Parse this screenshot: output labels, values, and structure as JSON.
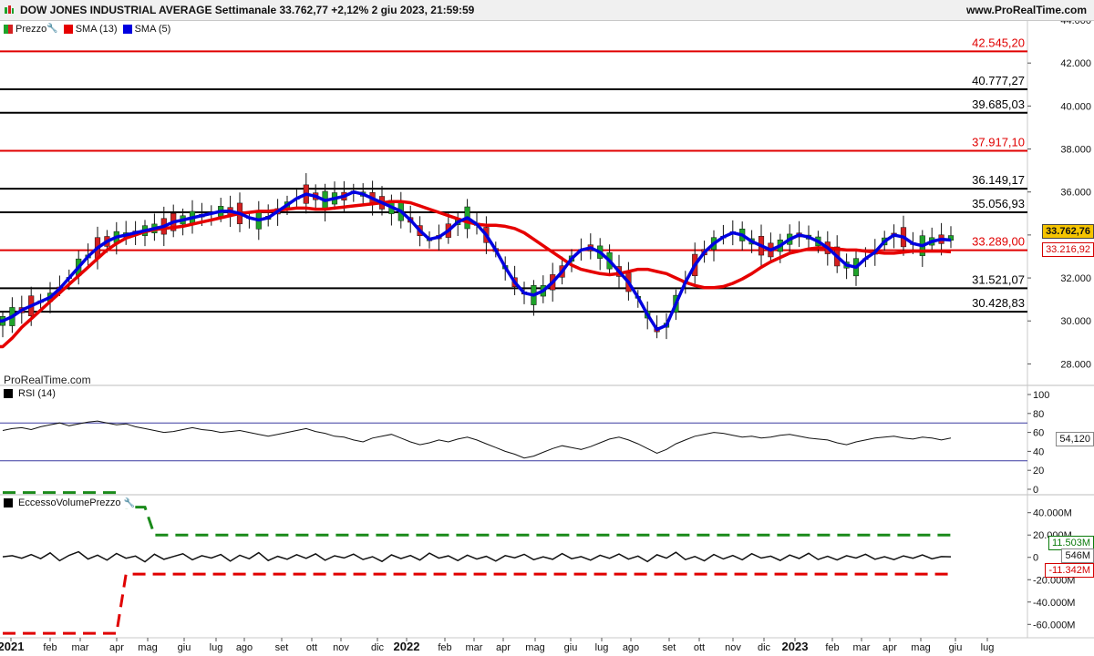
{
  "header": {
    "title": "DOW JONES INDUSTRIAL AVERAGE Settimanale 33.762,77 +2,12% 2 giu 2023, 21:59:59",
    "site": "www.ProRealTime.com"
  },
  "legend": {
    "price": "Prezzo",
    "sma13": "SMA (13)",
    "sma5": "SMA (5)"
  },
  "watermark": "ProRealTime.com",
  "rsi_label": "RSI (14)",
  "volume_label": "EccessoVolumePrezzo",
  "badges": {
    "close": "33.762,76",
    "sma13": "33.216,92",
    "rsi": "54,120",
    "vol_pos": "11.503M",
    "vol_value": "546M",
    "vol_neg": "-11.342M"
  },
  "colors": {
    "up": "#1fa32a",
    "down": "#d42020",
    "sma13": "#e60000",
    "sma5": "#0000e0",
    "level_red": "#e00000",
    "level_black": "#000000"
  },
  "chart_data": [
    {
      "type": "candlestick",
      "title": "DOW JONES INDUSTRIAL AVERAGE Settimanale",
      "ylim": [
        27000,
        44000
      ],
      "y_ticks": [
        "28.000",
        "30.000",
        "32.000",
        "34.000",
        "36.000",
        "38.000",
        "40.000",
        "42.000",
        "44.000"
      ],
      "x_ticks": [
        "2021",
        "feb",
        "mar",
        "apr",
        "mag",
        "giu",
        "lug",
        "ago",
        "set",
        "ott",
        "nov",
        "dic",
        "2022",
        "feb",
        "mar",
        "apr",
        "mag",
        "giu",
        "lug",
        "ago",
        "set",
        "ott",
        "nov",
        "dic",
        "2023",
        "feb",
        "mar",
        "apr",
        "mag",
        "giu",
        "lug"
      ],
      "levels": [
        {
          "value": 42545.2,
          "label": "42.545,20",
          "color": "red"
        },
        {
          "value": 40777.27,
          "label": "40.777,27",
          "color": "black"
        },
        {
          "value": 39685.03,
          "label": "39.685,03",
          "color": "black"
        },
        {
          "value": 37917.1,
          "label": "37.917,10",
          "color": "red"
        },
        {
          "value": 36149.17,
          "label": "36.149,17",
          "color": "black"
        },
        {
          "value": 35056.93,
          "label": "35.056,93",
          "color": "black"
        },
        {
          "value": 33289.0,
          "label": "33.289,00",
          "color": "red"
        },
        {
          "value": 31521.07,
          "label": "31.521,07",
          "color": "black"
        },
        {
          "value": 30428.83,
          "label": "30.428,83",
          "color": "black"
        }
      ],
      "series": [
        {
          "name": "SMA (13)",
          "values": [
            28800,
            29200,
            29700,
            30100,
            30500,
            30900,
            31300,
            31700,
            32100,
            32500,
            32900,
            33300,
            33600,
            33850,
            34000,
            34150,
            34250,
            34300,
            34350,
            34400,
            34500,
            34600,
            34700,
            34800,
            34900,
            35000,
            35050,
            35100,
            35100,
            35150,
            35200,
            35250,
            35250,
            35200,
            35200,
            35250,
            35300,
            35350,
            35400,
            35450,
            35500,
            35550,
            35550,
            35500,
            35350,
            35200,
            35050,
            34900,
            34750,
            34600,
            34500,
            34450,
            34450,
            34400,
            34300,
            34100,
            33800,
            33500,
            33200,
            32900,
            32600,
            32400,
            32300,
            32200,
            32150,
            32200,
            32300,
            32400,
            32400,
            32300,
            32200,
            32000,
            31800,
            31650,
            31550,
            31550,
            31600,
            31750,
            31950,
            32200,
            32500,
            32750,
            32950,
            33150,
            33250,
            33350,
            33400,
            33400,
            33350,
            33300,
            33300,
            33250,
            33200,
            33150,
            33150,
            33200,
            33250,
            33250,
            33250,
            33250,
            33216
          ]
        },
        {
          "name": "SMA (5)",
          "values": [
            30000,
            30200,
            30500,
            30700,
            30900,
            31100,
            31500,
            32000,
            32500,
            33000,
            33400,
            33700,
            33900,
            34000,
            34100,
            34200,
            34300,
            34400,
            34600,
            34700,
            34800,
            34900,
            35000,
            35100,
            35100,
            35000,
            34800,
            34700,
            34800,
            35100,
            35400,
            35700,
            35900,
            35800,
            35600,
            35700,
            35800,
            36000,
            35900,
            35700,
            35500,
            35300,
            35100,
            34700,
            34200,
            33800,
            33900,
            34200,
            34600,
            34800,
            34500,
            34000,
            33300,
            32500,
            31800,
            31300,
            31200,
            31400,
            31800,
            32300,
            32900,
            33300,
            33400,
            33200,
            32800,
            32300,
            31800,
            31100,
            30300,
            29600,
            29800,
            30800,
            31800,
            32600,
            33200,
            33600,
            33900,
            34100,
            34000,
            33700,
            33500,
            33300,
            33500,
            33800,
            34000,
            33900,
            33700,
            33400,
            33000,
            32600,
            32500,
            32900,
            33200,
            33700,
            34000,
            33900,
            33600,
            33500,
            33700,
            33800,
            33762
          ]
        }
      ]
    },
    {
      "type": "line",
      "title": "RSI (14)",
      "ylim": [
        0,
        100
      ],
      "y_ticks": [
        "0",
        "20",
        "40",
        "60",
        "80",
        "100"
      ],
      "overbought": 70,
      "oversold": 30,
      "values": [
        62,
        64,
        65,
        63,
        66,
        68,
        70,
        67,
        69,
        71,
        72,
        70,
        68,
        69,
        66,
        64,
        62,
        60,
        61,
        63,
        65,
        63,
        62,
        60,
        61,
        62,
        60,
        58,
        56,
        58,
        60,
        62,
        64,
        61,
        59,
        56,
        55,
        52,
        50,
        54,
        56,
        58,
        54,
        50,
        47,
        49,
        52,
        50,
        53,
        55,
        52,
        48,
        44,
        40,
        37,
        33,
        35,
        39,
        43,
        46,
        44,
        42,
        45,
        49,
        53,
        55,
        52,
        48,
        43,
        38,
        42,
        48,
        52,
        56,
        58,
        60,
        59,
        57,
        55,
        56,
        54,
        55,
        57,
        58,
        56,
        54,
        53,
        52,
        49,
        47,
        50,
        52,
        54,
        55,
        56,
        54,
        53,
        55,
        54,
        52,
        54
      ]
    },
    {
      "type": "line",
      "title": "EccessoVolumePrezzo",
      "ylim": [
        -72000,
        52000
      ],
      "y_ticks": [
        "-60.000M",
        "-40.000M",
        "-20.000M",
        "0",
        "20.000M",
        "40.000M"
      ],
      "series": [
        {
          "name": "EccessoVolumePrezzo",
          "values": [
            500,
            1500,
            -800,
            2500,
            -1200,
            4000,
            -3000,
            1800,
            5000,
            -1500,
            2000,
            -2500,
            3500,
            -800,
            1200,
            -4000,
            2800,
            -1800,
            800,
            3200,
            -2200,
            1500,
            -600,
            2600,
            -3400,
            1900,
            -1300,
            4200,
            -2800,
            900,
            -1700,
            2400,
            -900,
            3100,
            -2600,
            1400,
            -500,
            2900,
            -1900,
            600,
            -3600,
            2200,
            -1100,
            1700,
            -2400,
            3800,
            -700,
            1300,
            -2900,
            2000,
            -1500,
            900,
            -3300,
            1600,
            -400,
            2700,
            -2100,
            500,
            -1800,
            3400,
            -1200,
            700,
            -2500,
            1900,
            -900,
            3000,
            -1600,
            1200,
            -3800,
            2300,
            -700,
            4500,
            -2000,
            800,
            -3100,
            2600,
            -1400,
            1700,
            -2200,
            3300,
            -600,
            1100,
            -2700,
            2100,
            -1000,
            3600,
            -1900,
            900,
            -2300,
            1500,
            -600,
            2800,
            -1700,
            600,
            -2000,
            1300,
            -800,
            2200,
            -1300,
            700,
            546
          ]
        },
        {
          "name": "upper",
          "values": [
            58000,
            58000,
            58000,
            58000,
            58000,
            58000,
            58000,
            58000,
            58000,
            58000,
            58000,
            58000,
            58000,
            45000,
            45000,
            45000,
            20000,
            20000,
            20000,
            20000,
            20000,
            20000,
            20000,
            20000,
            20000,
            20000,
            20000,
            20000,
            20000,
            20000,
            20000,
            20000,
            20000,
            20000,
            20000,
            20000,
            20000,
            20000,
            20000,
            20000,
            20000,
            20000,
            20000,
            20000,
            20000,
            20000,
            20000,
            20000,
            20000,
            20000,
            20000,
            20000,
            20000,
            20000,
            20000,
            20000,
            20000,
            20000,
            20000,
            20000,
            20000,
            20000,
            20000,
            20000,
            20000,
            20000,
            20000,
            20000,
            20000,
            20000,
            20000,
            20000,
            20000,
            20000,
            20000,
            20000,
            20000,
            20000,
            20000,
            20000,
            20000,
            20000,
            20000,
            20000,
            20000,
            20000,
            20000,
            20000,
            20000,
            20000,
            20000,
            20000,
            20000,
            20000,
            20000,
            20000,
            20000,
            20000,
            20000,
            20000,
            20000
          ]
        },
        {
          "name": "lower",
          "values": [
            -68000,
            -68000,
            -68000,
            -68000,
            -68000,
            -68000,
            -68000,
            -68000,
            -68000,
            -68000,
            -68000,
            -68000,
            -68000,
            -15000,
            -15000,
            -15000,
            -15000,
            -15000,
            -15000,
            -15000,
            -15000,
            -15000,
            -15000,
            -15000,
            -15000,
            -15000,
            -15000,
            -15000,
            -15000,
            -15000,
            -15000,
            -15000,
            -15000,
            -15000,
            -15000,
            -15000,
            -15000,
            -15000,
            -15000,
            -15000,
            -15000,
            -15000,
            -15000,
            -15000,
            -15000,
            -15000,
            -15000,
            -15000,
            -15000,
            -15000,
            -15000,
            -15000,
            -15000,
            -15000,
            -15000,
            -15000,
            -15000,
            -15000,
            -15000,
            -15000,
            -15000,
            -15000,
            -15000,
            -15000,
            -15000,
            -15000,
            -15000,
            -15000,
            -15000,
            -15000,
            -15000,
            -15000,
            -15000,
            -15000,
            -15000,
            -15000,
            -15000,
            -15000,
            -15000,
            -15000,
            -15000,
            -15000,
            -15000,
            -15000,
            -15000,
            -15000,
            -15000,
            -15000,
            -15000,
            -15000,
            -15000,
            -15000,
            -15000,
            -15000,
            -15000,
            -15000,
            -15000,
            -15000,
            -15000,
            -15000,
            -15000
          ]
        }
      ]
    }
  ]
}
